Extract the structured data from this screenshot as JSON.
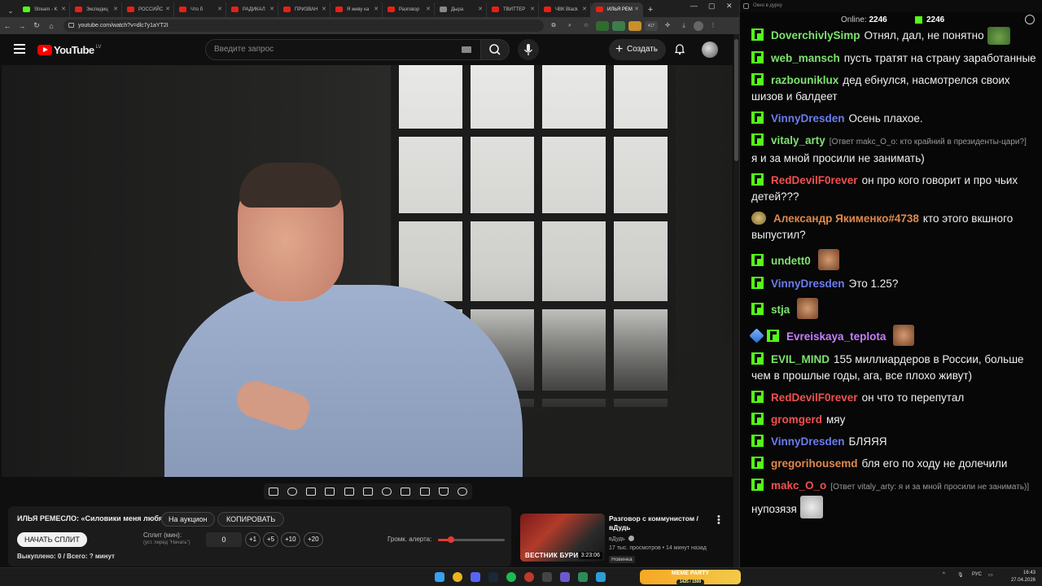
{
  "browser": {
    "tabs": [
      {
        "label": "Stream - K",
        "fav": "k"
      },
      {
        "label": "Экспедиц",
        "fav": "yt"
      },
      {
        "label": "РОССИЙС",
        "fav": "yt"
      },
      {
        "label": "Что б",
        "fav": "yt"
      },
      {
        "label": "РАДИКАЛ",
        "fav": "yt"
      },
      {
        "label": "ПРИЗВАН",
        "fav": "yt"
      },
      {
        "label": "Я живу ка",
        "fav": "yt"
      },
      {
        "label": "Разговор",
        "fav": "yt"
      },
      {
        "label": "Дыра",
        "fav": "dj"
      },
      {
        "label": "ТВИТТЕР",
        "fav": "yt"
      },
      {
        "label": "ЧВК Black",
        "fav": "yt"
      },
      {
        "label": "ИЛЬЯ РЕМ",
        "fav": "yt"
      }
    ],
    "active_tab_index": 11,
    "url": "youtube.com/watch?v=dlc7y1aYT2I",
    "ext_badge": "417"
  },
  "youtube": {
    "logo": "YouTube",
    "country": "LV",
    "search_placeholder": "Введите запрос",
    "create_label": "Создать"
  },
  "panel": {
    "title": "ИЛЬЯ РЕМЕСЛО: «Силовики меня любят»",
    "auction_label": "На аукцион",
    "copy_label": "КОПИРОВАТЬ",
    "start_split_label": "НАЧАТЬ СПЛИТ",
    "split_label": "Сплит (мин):",
    "split_hint": "(уст. перед \"Начать\")",
    "split_value": "0",
    "steps": [
      "+1",
      "+5",
      "+10",
      "+20"
    ],
    "alert_label": "Громк. алерта:",
    "alert_volume": 0.2,
    "bought": "Выкуплено: 0 / Всего: ? минут"
  },
  "recommended": {
    "thumb_text": "ВЕСТНИК БУРИ",
    "duration": "3:23:06",
    "title": "Разговор с коммунистом / вДудь",
    "channel": "вДудь",
    "meta": "17 тыс. просмотров • 14 минут назад",
    "badge": "Новинка"
  },
  "chat": {
    "window_title": "Окно в дурку",
    "online_label": "Online:",
    "online_count": "2246",
    "k_count": "2246",
    "messages": [
      {
        "user": "DoverchivlySimp",
        "color": "#7de26e",
        "text": "Отнял, дал, не понятно",
        "reply": "",
        "emote": "pepe",
        "badge": "k"
      },
      {
        "user": "web_mansch",
        "color": "#7de26e",
        "text": "пусть тратят на страну заработанные",
        "reply": "",
        "emote": "",
        "badge": "k"
      },
      {
        "user": "razbouniklux",
        "color": "#7de26e",
        "text": "дед ебнулся, насмотрелся своих шизов и балдеет",
        "reply": "",
        "emote": "",
        "badge": "k"
      },
      {
        "user": "VinnyDresden",
        "color": "#6b7cf0",
        "text": "Осень плахое.",
        "reply": "",
        "emote": "",
        "badge": "k"
      },
      {
        "user": "vitaly_arty",
        "color": "#7de26e",
        "text": "я и за мной просили не занимать)",
        "reply": "[Ответ makc_O_o: кто крайний в президенты-цари?]",
        "emote": "",
        "badge": "k"
      },
      {
        "user": "RedDevilF0rever",
        "color": "#f05050",
        "text": "он про кого говорит и про чьих детей???",
        "reply": "",
        "emote": "",
        "badge": "k"
      },
      {
        "user": "Александр Якименко#4738",
        "color": "#e0884a",
        "text": "кто этого вкшного выпустил?",
        "reply": "",
        "emote": "",
        "badge": "avatar"
      },
      {
        "user": "undett0",
        "color": "#7de26e",
        "text": "",
        "reply": "",
        "emote": "face",
        "badge": "k"
      },
      {
        "user": "VinnyDresden",
        "color": "#6b7cf0",
        "text": "Это 1.25?",
        "reply": "",
        "emote": "",
        "badge": "k"
      },
      {
        "user": "stja",
        "color": "#7de26e",
        "text": "",
        "reply": "",
        "emote": "face",
        "badge": "k"
      },
      {
        "user": "Evreiskaya_teplota",
        "color": "#c77dff",
        "text": "",
        "reply": "",
        "emote": "face",
        "badge": "sword"
      },
      {
        "user": "EVIL_MIND",
        "color": "#7de26e",
        "text": "155 миллиардеров в России, больше чем в прошлые годы, ага, все плохо живут)",
        "reply": "",
        "emote": "",
        "badge": "k"
      },
      {
        "user": "RedDevilF0rever",
        "color": "#f05050",
        "text": "он что то перепутал",
        "reply": "",
        "emote": "",
        "badge": "k"
      },
      {
        "user": "gromgerd",
        "color": "#f05050",
        "text": "мяу",
        "reply": "",
        "emote": "",
        "badge": "k"
      },
      {
        "user": "VinnyDresden",
        "color": "#6b7cf0",
        "text": "БЛЯЯЯ",
        "reply": "",
        "emote": "",
        "badge": "k"
      },
      {
        "user": "gregorihousemd",
        "color": "#e0884a",
        "text": "бля его по ходу не долечили",
        "reply": "",
        "emote": "",
        "badge": "k"
      },
      {
        "user": "makc_O_o",
        "color": "#f05050",
        "text": "нупозязя",
        "reply": "[Ответ vitaly_arty: я и за мной просили не занимать)]",
        "emote": "cat",
        "badge": "k"
      }
    ]
  },
  "taskbar": {
    "meme_title": "MEME PARTY",
    "meme_sub": "1425 / 1500",
    "lang": "РУС",
    "time": "16:43",
    "date": "27.04.2026"
  }
}
